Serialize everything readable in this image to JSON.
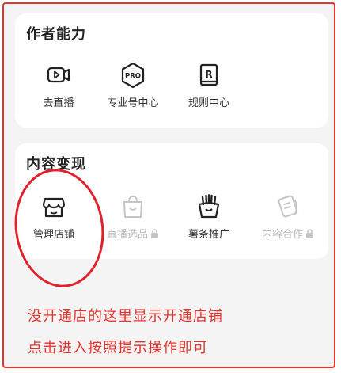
{
  "creator_section": {
    "title": "作者能力",
    "items": [
      {
        "label": "去直播",
        "icon": "live-video-icon"
      },
      {
        "label": "专业号中心",
        "icon": "pro-badge-icon"
      },
      {
        "label": "规则中心",
        "icon": "rules-book-icon"
      }
    ]
  },
  "monetize_section": {
    "title": "内容变现",
    "items": [
      {
        "label": "管理店铺",
        "icon": "store-icon",
        "enabled": true
      },
      {
        "label": "直播选品",
        "icon": "shopping-bag-icon",
        "enabled": false
      },
      {
        "label": "薯条推广",
        "icon": "fries-icon",
        "enabled": true
      },
      {
        "label": "内容合作",
        "icon": "cooperation-icon",
        "enabled": false
      }
    ]
  },
  "annotation": {
    "line1": "没开通店的这里显示开通店铺",
    "line2": "点击进入按照提示操作即可"
  },
  "colors": {
    "accent": "#e5322d",
    "disabled": "#b9b9b9",
    "background": "#f4f4f4"
  }
}
